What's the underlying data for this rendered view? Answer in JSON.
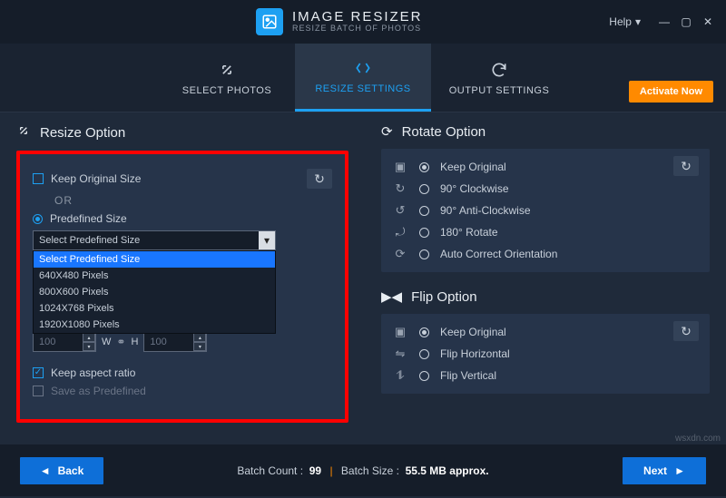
{
  "app": {
    "title": "IMAGE RESIZER",
    "subtitle": "RESIZE BATCH OF PHOTOS"
  },
  "titlebar": {
    "help": "Help"
  },
  "tabs": {
    "select": "SELECT PHOTOS",
    "resize": "RESIZE SETTINGS",
    "output": "OUTPUT SETTINGS",
    "activate": "Activate Now"
  },
  "resize": {
    "heading": "Resize Option",
    "keep_original": "Keep Original Size",
    "or": "OR",
    "predefined": "Predefined Size",
    "select_label": "Select Predefined Size",
    "options": [
      "Select Predefined Size",
      "640X480 Pixels",
      "800X600 Pixels",
      "1024X768 Pixels",
      "1920X1080 Pixels"
    ],
    "w_label": "W",
    "h_label": "H",
    "w_value": "100",
    "h_value": "100",
    "keep_aspect": "Keep aspect ratio",
    "save_predef": "Save as Predefined"
  },
  "rotate": {
    "heading": "Rotate Option",
    "items": [
      "Keep Original",
      "90° Clockwise",
      "90° Anti-Clockwise",
      "180° Rotate",
      "Auto Correct Orientation"
    ]
  },
  "flip": {
    "heading": "Flip Option",
    "items": [
      "Keep Original",
      "Flip Horizontal",
      "Flip Vertical"
    ]
  },
  "footer": {
    "back": "Back",
    "next": "Next",
    "count_label": "Batch Count :",
    "count_value": "99",
    "size_label": "Batch Size :",
    "size_value": "55.5 MB approx."
  },
  "watermark": "wsxdn.com"
}
